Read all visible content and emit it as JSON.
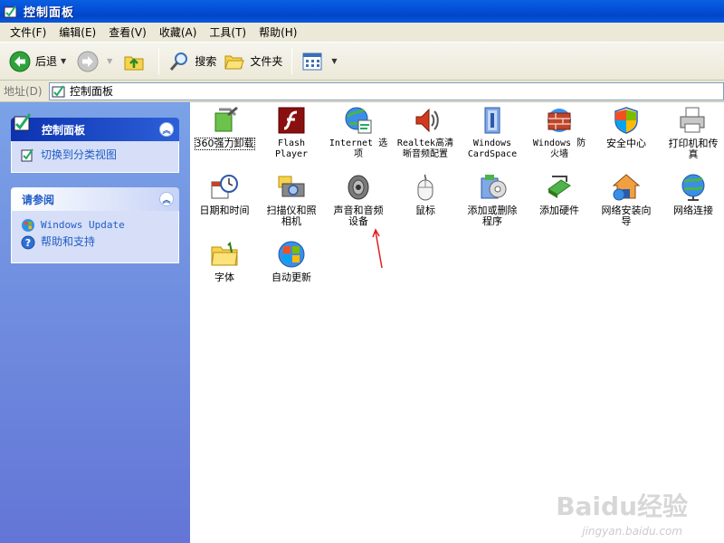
{
  "window": {
    "title": "控制面板"
  },
  "menu": [
    "文件(F)",
    "编辑(E)",
    "查看(V)",
    "收藏(A)",
    "工具(T)",
    "帮助(H)"
  ],
  "toolbar": {
    "back_label": "后退",
    "search_label": "搜索",
    "folders_label": "文件夹"
  },
  "address": {
    "label": "地址(D)",
    "value": "控制面板"
  },
  "sidebar": {
    "panel1": {
      "title": "控制面板",
      "links": [
        "切换到分类视图"
      ]
    },
    "panel2": {
      "title": "请参阅",
      "links": [
        "Windows Update",
        "帮助和支持"
      ]
    }
  },
  "icons": [
    {
      "label": "360强力卸载",
      "icon": "uninstall-icon"
    },
    {
      "label": "Flash\nPlayer",
      "icon": "flash-icon"
    },
    {
      "label": "Internet 选\n项",
      "icon": "internet-options-icon"
    },
    {
      "label": "Realtek高清\n晰音频配置",
      "icon": "realtek-audio-icon"
    },
    {
      "label": "Windows\nCardSpace",
      "icon": "cardspace-icon"
    },
    {
      "label": "Windows 防\n火墙",
      "icon": "firewall-icon"
    },
    {
      "label": "安全中心",
      "icon": "security-center-icon"
    },
    {
      "label": "打印机和传\n真",
      "icon": "printer-icon"
    },
    {
      "label": "日期和时间",
      "icon": "date-time-icon"
    },
    {
      "label": "扫描仪和照\n相机",
      "icon": "scanner-icon"
    },
    {
      "label": "声音和音频\n设备",
      "icon": "sound-icon"
    },
    {
      "label": "鼠标",
      "icon": "mouse-icon"
    },
    {
      "label": "添加或删除\n程序",
      "icon": "add-remove-icon"
    },
    {
      "label": "添加硬件",
      "icon": "add-hardware-icon"
    },
    {
      "label": "网络安装向\n导",
      "icon": "network-wizard-icon"
    },
    {
      "label": "网络连接",
      "icon": "network-connections-icon"
    },
    {
      "label": "字体",
      "icon": "fonts-icon"
    },
    {
      "label": "自动更新",
      "icon": "auto-update-icon"
    }
  ],
  "watermark": {
    "logo": "Baidu经验",
    "url": "jingyan.baidu.com"
  }
}
